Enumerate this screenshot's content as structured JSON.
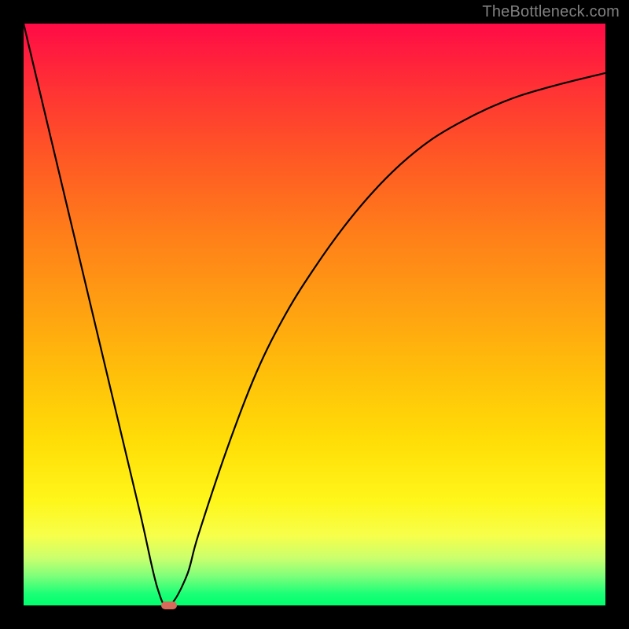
{
  "watermark": "TheBottleneck.com",
  "chart_data": {
    "type": "line",
    "title": "",
    "xlabel": "",
    "ylabel": "",
    "xlim": [
      0,
      100
    ],
    "ylim": [
      0,
      100
    ],
    "grid": false,
    "legend": false,
    "series": [
      {
        "name": "bottleneck-curve",
        "x": [
          0,
          5,
          10,
          15,
          20,
          23,
          25,
          28,
          30,
          35,
          40,
          45,
          50,
          55,
          60,
          65,
          70,
          75,
          80,
          85,
          90,
          95,
          100
        ],
        "values": [
          100,
          79,
          58,
          37,
          16,
          3,
          0,
          5,
          12,
          27,
          40,
          50,
          58,
          65,
          71,
          76,
          80,
          83,
          85.5,
          87.5,
          89,
          90.3,
          91.5
        ]
      }
    ],
    "marker": {
      "x": 25,
      "y": 0
    },
    "colors": {
      "curve": "#000000",
      "marker": "#d86a5c",
      "gradient_top": "#ff0b46",
      "gradient_bottom": "#00ff6e",
      "frame": "#000000"
    }
  }
}
